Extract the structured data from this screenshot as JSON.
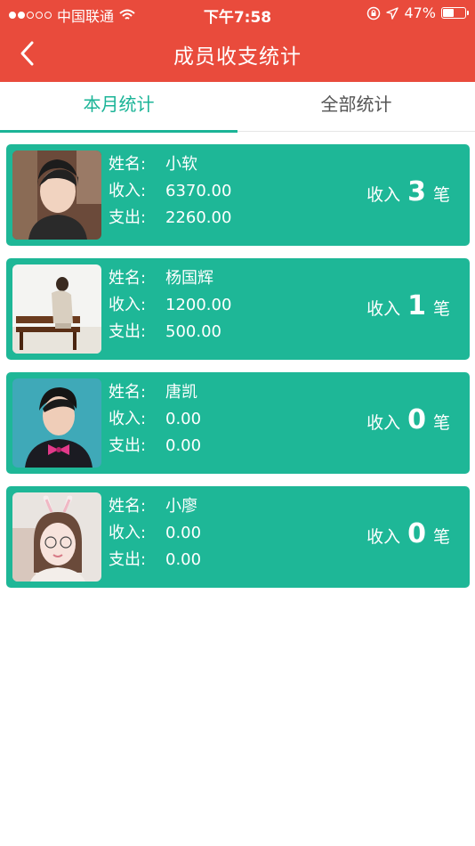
{
  "status_bar": {
    "carrier": "中国联通",
    "time": "下午7:58",
    "battery_text": "47%",
    "battery_level": 0.47
  },
  "nav": {
    "title": "成员收支统计"
  },
  "tabs": [
    {
      "label": "本月统计",
      "active": true
    },
    {
      "label": "全部统计",
      "active": false
    }
  ],
  "labels": {
    "name": "姓名:",
    "income": "收入:",
    "expense": "支出:",
    "summary_prefix": "收入",
    "summary_unit": "笔"
  },
  "members": [
    {
      "name": "小软",
      "income": "6370.00",
      "expense": "2260.00",
      "count": "3"
    },
    {
      "name": "杨国辉",
      "income": "1200.00",
      "expense": "500.00",
      "count": "1"
    },
    {
      "name": "唐凯",
      "income": "0.00",
      "expense": "0.00",
      "count": "0"
    },
    {
      "name": "小廖",
      "income": "0.00",
      "expense": "0.00",
      "count": "0"
    }
  ],
  "colors": {
    "header": "#e94b3c",
    "accent": "#1bb497",
    "card": "#1eb797"
  }
}
